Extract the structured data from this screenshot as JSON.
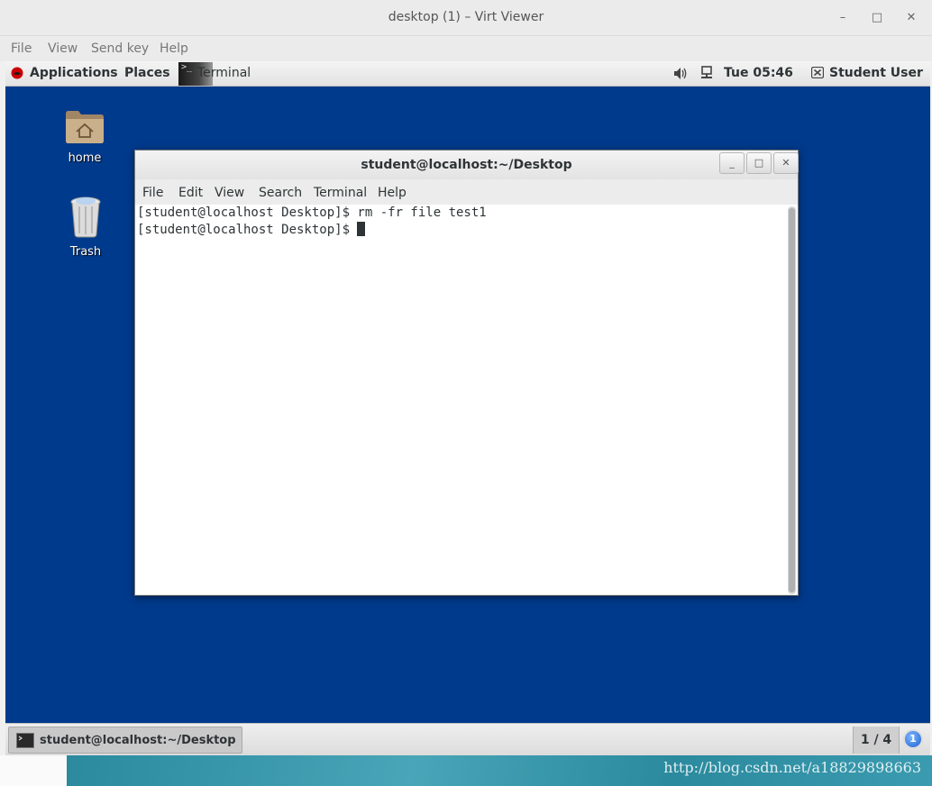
{
  "host": {
    "title": "desktop (1) – Virt Viewer",
    "menu": [
      "File",
      "View",
      "Send key",
      "Help"
    ],
    "controls": {
      "minimize": "–",
      "maximize": "□",
      "close": "✕"
    }
  },
  "top_panel": {
    "applications": "Applications",
    "places": "Places",
    "active_app": "Terminal",
    "clock": "Tue 05:46",
    "user": "Student User",
    "term_glyph": ">_"
  },
  "desktop_icons": [
    {
      "label": "home"
    },
    {
      "label": "Trash"
    }
  ],
  "terminal": {
    "title": "student@localhost:~/Desktop",
    "menu": [
      "File",
      "Edit",
      "View",
      "Search",
      "Terminal",
      "Help"
    ],
    "lines": [
      "[student@localhost Desktop]$ rm -fr file test1",
      "[student@localhost Desktop]$ "
    ]
  },
  "bottom_panel": {
    "task_label": "student@localhost:~/Desktop",
    "workspace": "1 / 4",
    "workspace_badge": "1"
  },
  "watermark": "http://blog.csdn.net/a18829898663"
}
